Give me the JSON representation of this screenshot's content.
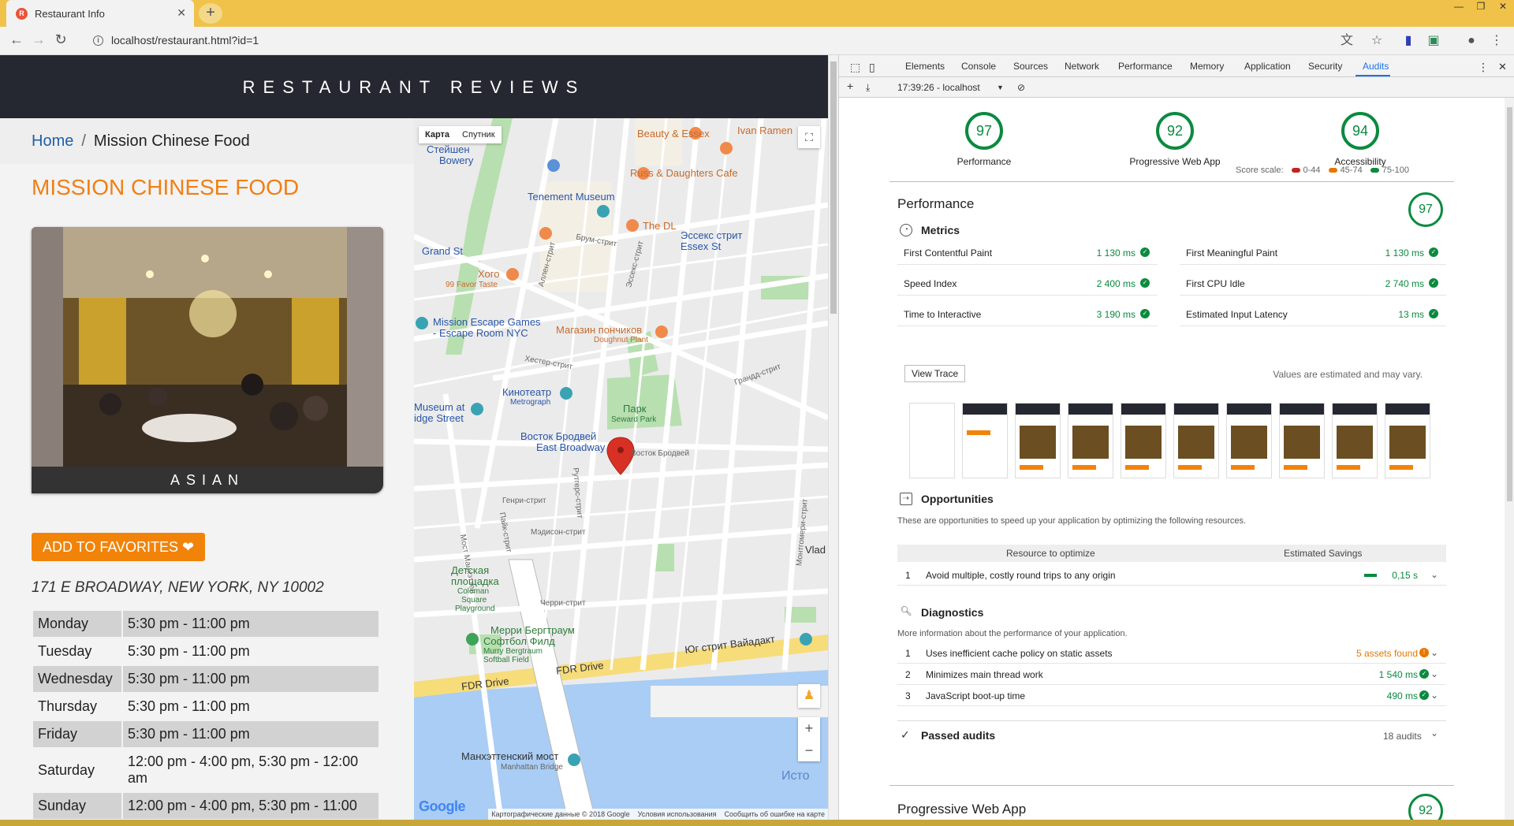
{
  "browser": {
    "tab_title": "Restaurant Info",
    "url": "localhost/restaurant.html?id=1"
  },
  "site": {
    "title": "RESTAURANT REVIEWS",
    "breadcrumb": {
      "home": "Home",
      "separator": "/",
      "current": "Mission Chinese Food"
    },
    "restaurant_name": "MISSION CHINESE FOOD",
    "cuisine": "ASIAN",
    "favorites_button": "ADD TO FAVORITES ❤",
    "address": "171 E BROADWAY, NEW YORK, NY 10002",
    "hours": [
      {
        "day": "Monday",
        "time": "5:30 pm - 11:00 pm"
      },
      {
        "day": "Tuesday",
        "time": "5:30 pm - 11:00 pm"
      },
      {
        "day": "Wednesday",
        "time": "5:30 pm - 11:00 pm"
      },
      {
        "day": "Thursday",
        "time": "5:30 pm - 11:00 pm"
      },
      {
        "day": "Friday",
        "time": "5:30 pm - 11:00 pm"
      },
      {
        "day": "Saturday",
        "time": "12:00 pm - 4:00 pm, 5:30 pm - 12:00 am"
      },
      {
        "day": "Sunday",
        "time": "12:00 pm - 4:00 pm, 5:30 pm - 11:00"
      }
    ]
  },
  "map": {
    "type_map": "Карта",
    "type_satellite": "Спутник",
    "logo": "Google",
    "attribution": [
      "Картографические данные © 2018 Google",
      "Условия использования",
      "Сообщить об ошибке на карте"
    ],
    "labels": {
      "l1": "Стейшен",
      "l2": "Bowery",
      "l3": "Beauty & Essex",
      "l4": "Ivan Ramen",
      "l5": "Russ & Daughters Cafe",
      "l6": "Tenement Museum",
      "l7": "The DL",
      "l8": "Эссекс стрит",
      "l9": "Essex St",
      "l10": "Grand St",
      "l11": "Хого",
      "l12": "99 Favor Taste",
      "l13": "Mission Escape Games",
      "l14": "- Escape Room NYC",
      "l15": "Магазин пончиков",
      "l16": "Doughnut Plant",
      "l17": "Кинотеатр",
      "l18": "Metrograph",
      "l19": "Museum at",
      "l20": "idge Street",
      "l21": "Парк",
      "l22": "Seward Park",
      "l23": "Восток Бродвей",
      "l24": "East Broadway",
      "l25": "Грандд-стрит",
      "l26": "Детская",
      "l27": "площадка",
      "l28": "Coleman",
      "l29": "Square",
      "l30": "Playground",
      "l31": "Мерри Бергтраум",
      "l32": "Софтбол Филд",
      "l33": "Murry Bergtraum",
      "l34": "Softball Field",
      "l35": "FDR Drive",
      "l36": "FDR Drive",
      "l37": "Юг стрит Вайадакт",
      "l38": "Манхэттенский мост",
      "l39": "Manhattan Bridge",
      "l40": "Исто",
      "l41": "Vlad",
      "l42": "Мост Манхэттен",
      "l43": "Пайк-стрит",
      "l44": "Генри-стрит",
      "l45": "Мэдисон-стрит",
      "l46": "Черри-стрит",
      "l47": "Монтгомери-стрит",
      "l48": "Аллен-стрит",
      "l49": "Эссекс-стрит",
      "l50": "Хестер-стрит",
      "l51": "Брум-стрит",
      "l52": "Восток Бродвей",
      "l53": "Рутгерс-стрит"
    }
  },
  "devtools": {
    "tabs": [
      "Elements",
      "Console",
      "Sources",
      "Network",
      "Performance",
      "Memory",
      "Application",
      "Security",
      "Audits"
    ],
    "active_tab": "Audits",
    "report_selector": "17:39:26 - localhost",
    "gauges": [
      {
        "label": "Performance",
        "score": "97"
      },
      {
        "label": "Progressive Web App",
        "score": "92"
      },
      {
        "label": "Accessibility",
        "score": "94"
      }
    ],
    "scale": {
      "label": "Score scale:",
      "low": "0-44",
      "mid": "45-74",
      "high": "75-100",
      "colors": {
        "low": "#c7221f",
        "mid": "#e67700",
        "high": "#0b8a3f"
      }
    },
    "performance": {
      "title": "Performance",
      "score": "97",
      "metrics_title": "Metrics",
      "metrics": [
        {
          "name": "First Contentful Paint",
          "value": "1 130 ms"
        },
        {
          "name": "First Meaningful Paint",
          "value": "1 130 ms"
        },
        {
          "name": "Speed Index",
          "value": "2 400 ms"
        },
        {
          "name": "First CPU Idle",
          "value": "2 740 ms"
        },
        {
          "name": "Time to Interactive",
          "value": "3 190 ms"
        },
        {
          "name": "Estimated Input Latency",
          "value": "13 ms"
        }
      ],
      "view_trace": "View Trace",
      "estimate_note": "Values are estimated and may vary.",
      "opportunities_title": "Opportunities",
      "opportunities_desc": "These are opportunities to speed up your application by optimizing the following resources.",
      "opp_col_resource": "Resource to optimize",
      "opp_col_savings": "Estimated Savings",
      "opportunities": [
        {
          "n": "1",
          "text": "Avoid multiple, costly round trips to any origin",
          "value": "0,15 s"
        }
      ],
      "diagnostics_title": "Diagnostics",
      "diagnostics_desc": "More information about the performance of your application.",
      "diagnostics": [
        {
          "n": "1",
          "text": "Uses inefficient cache policy on static assets",
          "value": "5 assets found"
        },
        {
          "n": "2",
          "text": "Minimizes main thread work",
          "value": "1 540 ms"
        },
        {
          "n": "3",
          "text": "JavaScript boot-up time",
          "value": "490 ms"
        }
      ],
      "passed_title": "Passed audits",
      "passed_count": "18 audits"
    },
    "pwa": {
      "title": "Progressive Web App",
      "score": "92"
    }
  }
}
